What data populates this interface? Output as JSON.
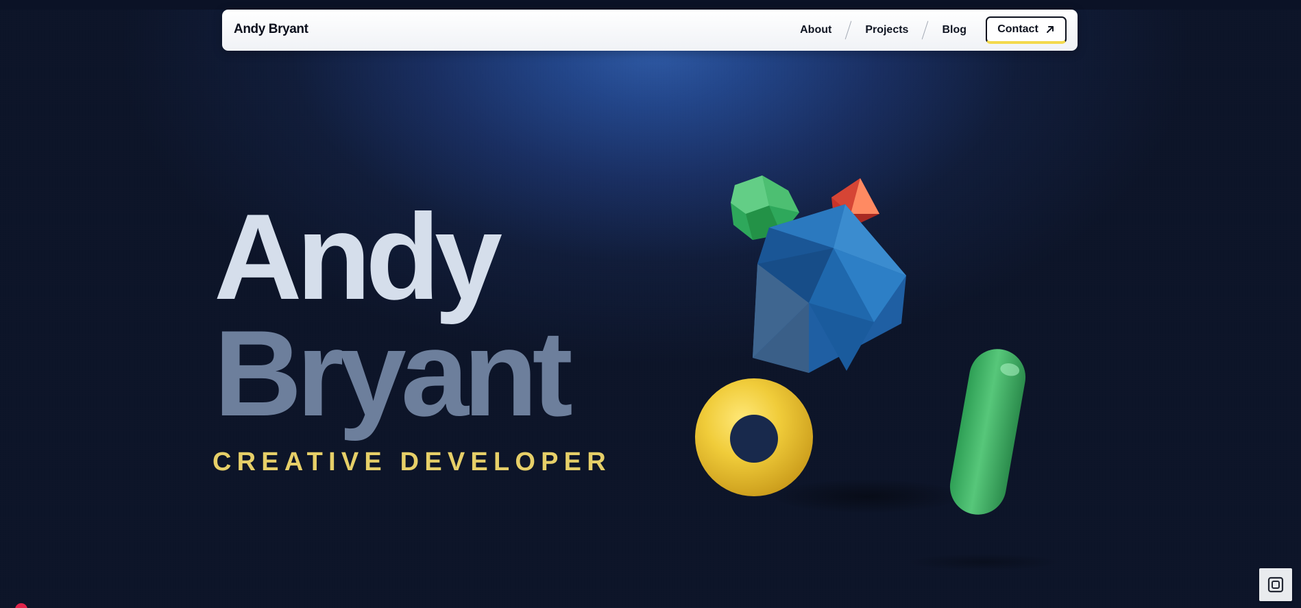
{
  "nav": {
    "brand": "Andy Bryant",
    "links": [
      "About",
      "Projects",
      "Blog"
    ],
    "contact_label": "Contact"
  },
  "hero": {
    "first_name": "Andy",
    "last_name": "Bryant",
    "subtitle": "CREATIVE DEVELOPER"
  },
  "scene": {
    "shapes": [
      "green-polyhedron-icon",
      "red-octahedron-icon",
      "blue-icosahedron-icon",
      "yellow-torus-icon",
      "green-capsule-icon"
    ]
  },
  "colors": {
    "accent_yellow": "#e6cf68",
    "hero_primary": "#d5deeb",
    "hero_secondary": "#6d7f9c",
    "background_dark": "#111d3a",
    "background_glow": "#2f5aa5"
  }
}
